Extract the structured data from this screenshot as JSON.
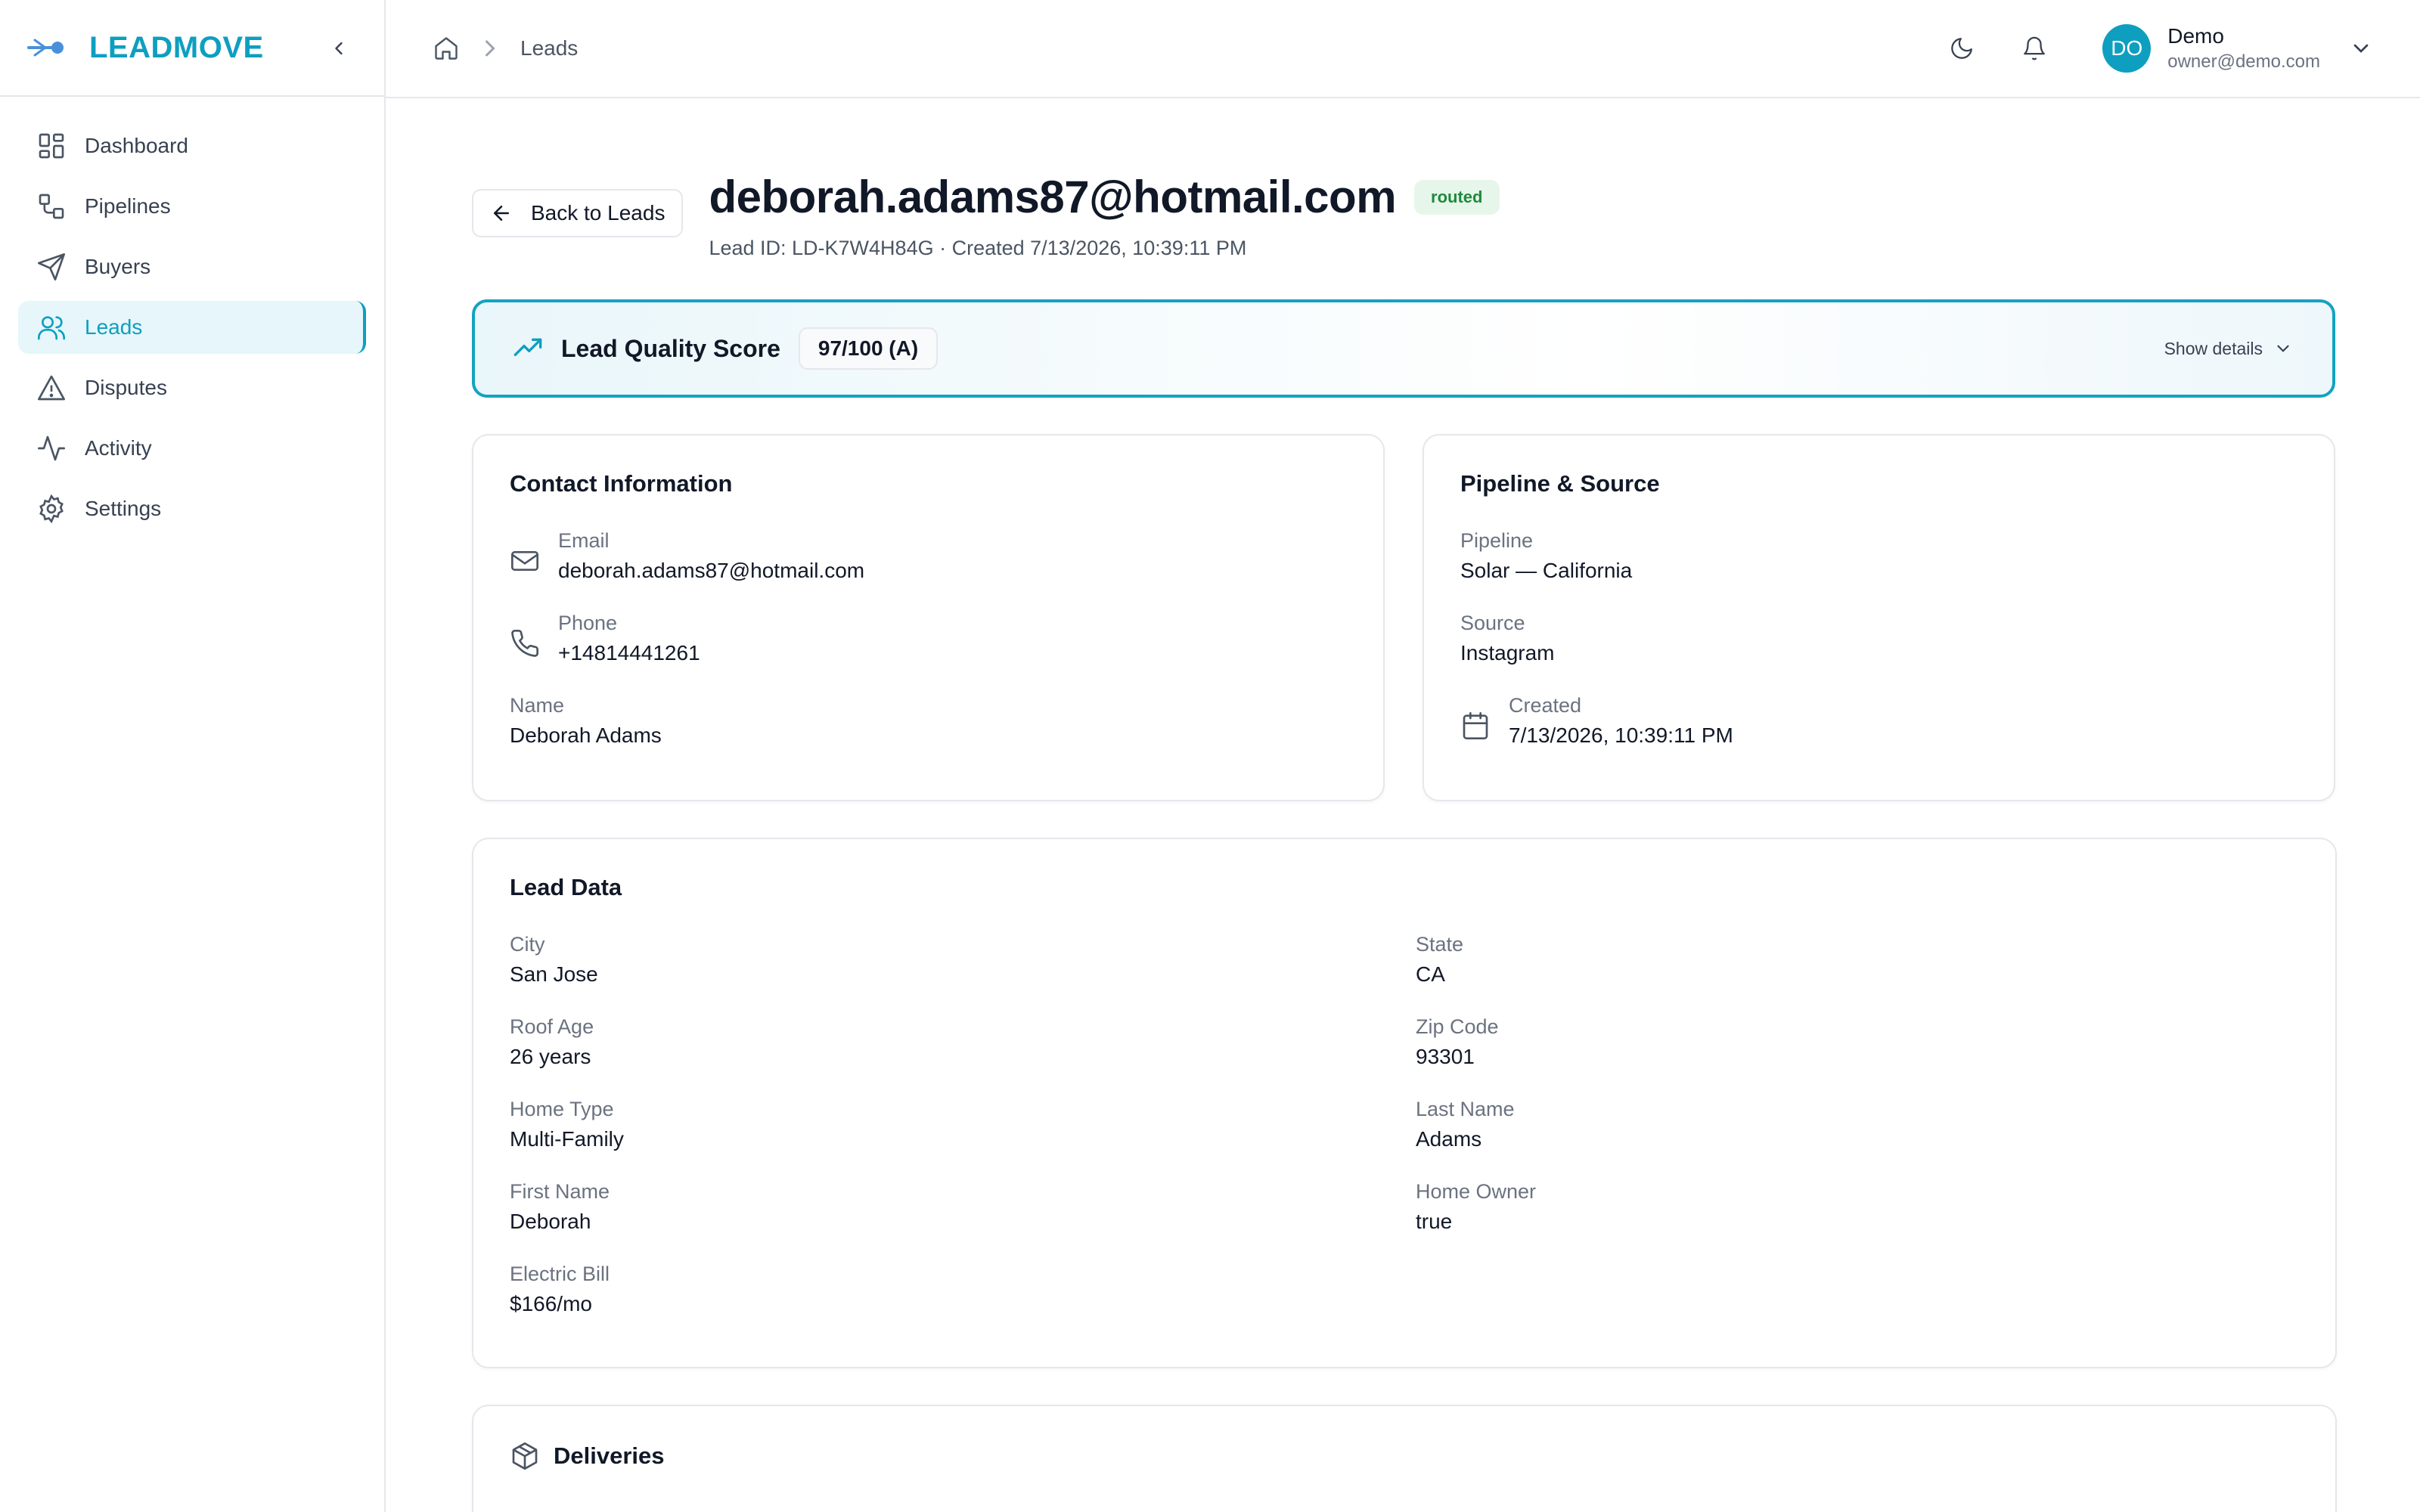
{
  "sidebar": {
    "brand": "LEADMOVE",
    "items": [
      {
        "label": "Dashboard"
      },
      {
        "label": "Pipelines"
      },
      {
        "label": "Buyers"
      },
      {
        "label": "Leads"
      },
      {
        "label": "Disputes"
      },
      {
        "label": "Activity"
      },
      {
        "label": "Settings"
      }
    ],
    "active_item": "Leads"
  },
  "topbar": {
    "breadcrumb_current": "Leads",
    "user": {
      "initials": "DO",
      "name": "Demo",
      "email": "owner@demo.com"
    }
  },
  "lead": {
    "back_label": "Back to Leads",
    "title": "deborah.adams87@hotmail.com",
    "status": "routed",
    "subtitle": "Lead ID: LD-K7W4H84G · Created 7/13/2026, 10:39:11 PM",
    "quality": {
      "title": "Lead Quality Score",
      "score": "97/100 (A)",
      "details_label": "Show details"
    },
    "contact": {
      "title": "Contact Information",
      "email_label": "Email",
      "email": "deborah.adams87@hotmail.com",
      "phone_label": "Phone",
      "phone": "+14814441261",
      "name_label": "Name",
      "name": "Deborah Adams"
    },
    "pipeline": {
      "title": "Pipeline & Source",
      "pipeline_label": "Pipeline",
      "pipeline": "Solar — California",
      "source_label": "Source",
      "source": "Instagram",
      "created_label": "Created",
      "created": "7/13/2026, 10:39:11 PM"
    },
    "lead_data": {
      "title": "Lead Data",
      "fields": [
        {
          "label": "City",
          "value": "San Jose"
        },
        {
          "label": "State",
          "value": "CA"
        },
        {
          "label": "Roof Age",
          "value": "26 years"
        },
        {
          "label": "Zip Code",
          "value": "93301"
        },
        {
          "label": "Home Type",
          "value": "Multi-Family"
        },
        {
          "label": "Last Name",
          "value": "Adams"
        },
        {
          "label": "First Name",
          "value": "Deborah"
        },
        {
          "label": "Home Owner",
          "value": "true"
        },
        {
          "label": "Electric Bill",
          "value": "$166/mo"
        }
      ]
    },
    "deliveries": {
      "title": "Deliveries"
    }
  },
  "colors": {
    "accent": "#0e9fc0",
    "status_green": "#1e8a3c",
    "border": "#e5e7eb"
  }
}
